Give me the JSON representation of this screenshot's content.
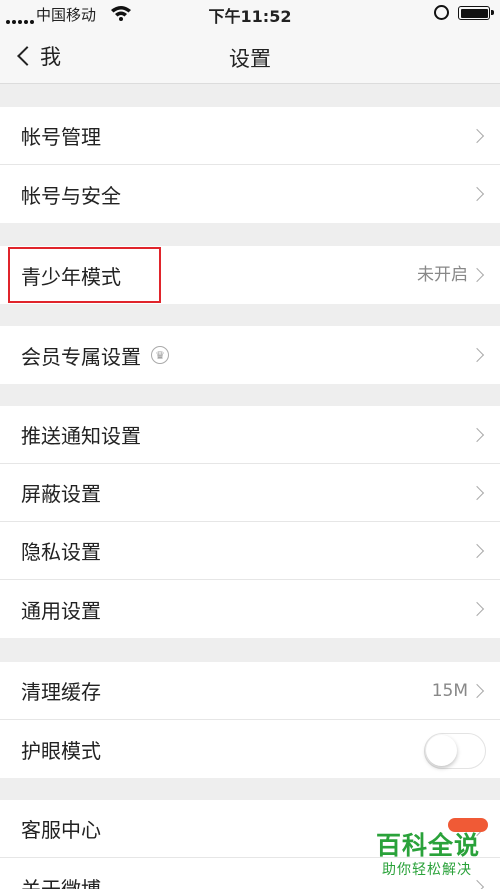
{
  "status_bar": {
    "carrier": "中国移动",
    "time": "下午11:52"
  },
  "nav": {
    "back_label": "我",
    "title": "设置"
  },
  "groups": [
    {
      "items": [
        {
          "label": "帐号管理"
        },
        {
          "label": "帐号与安全"
        }
      ]
    },
    {
      "items": [
        {
          "label": "青少年模式",
          "value": "未开启"
        }
      ]
    },
    {
      "items": [
        {
          "label": "会员专属设置"
        }
      ]
    },
    {
      "items": [
        {
          "label": "推送通知设置"
        },
        {
          "label": "屏蔽设置"
        },
        {
          "label": "隐私设置"
        },
        {
          "label": "通用设置"
        }
      ]
    },
    {
      "items": [
        {
          "label": "清理缓存",
          "value": "15M"
        },
        {
          "label": "护眼模式",
          "toggle": false
        }
      ]
    },
    {
      "items": [
        {
          "label": "客服中心"
        },
        {
          "label": "关于微博"
        }
      ]
    }
  ],
  "watermark": {
    "title": "百科全说",
    "subtitle": "助你轻松解决"
  },
  "colors": {
    "highlight": "#e0242b",
    "watermark_green": "#2aa23a"
  }
}
